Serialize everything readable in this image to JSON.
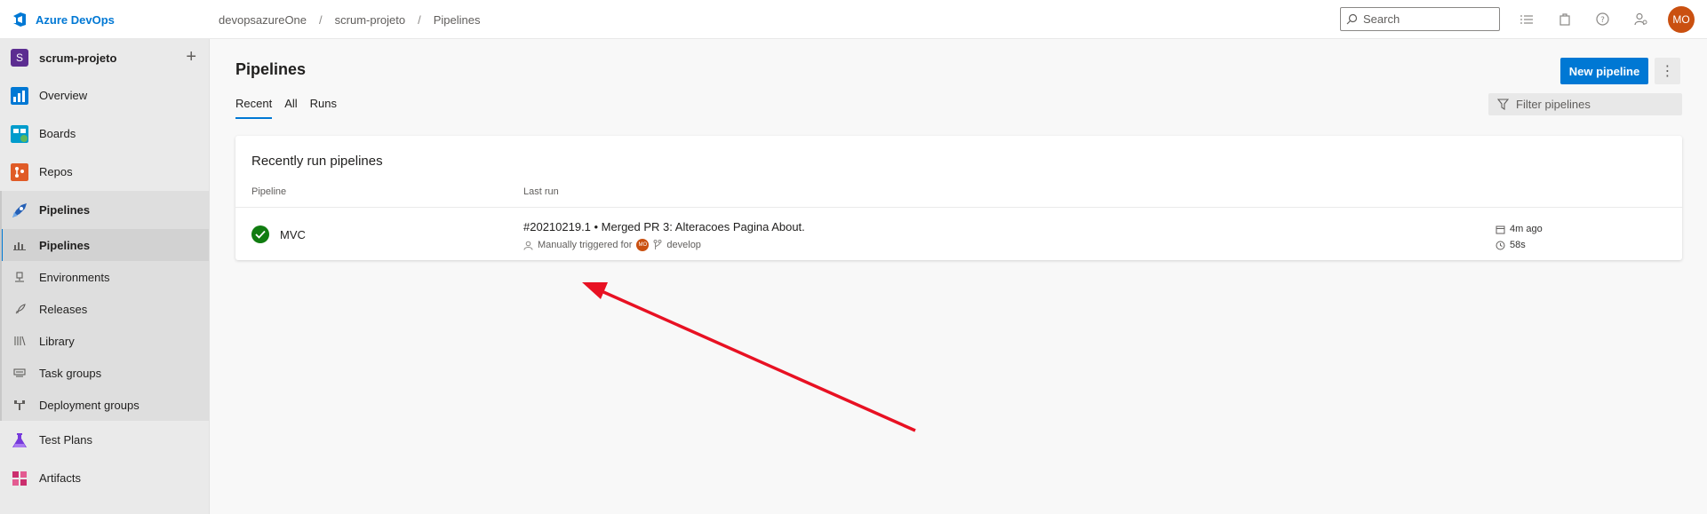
{
  "app": {
    "brand": "Azure DevOps"
  },
  "breadcrumb": [
    "devopsazureOne",
    "scrum-projeto",
    "Pipelines"
  ],
  "search": {
    "placeholder": "Search"
  },
  "user": {
    "initials": "MO",
    "color": "#ca5010"
  },
  "sidebar": {
    "project": {
      "badge": "S",
      "name": "scrum-projeto",
      "add": "+"
    },
    "items": [
      {
        "label": "Overview"
      },
      {
        "label": "Boards"
      },
      {
        "label": "Repos"
      },
      {
        "label": "Pipelines"
      }
    ],
    "sub_items": [
      {
        "label": "Pipelines"
      },
      {
        "label": "Environments"
      },
      {
        "label": "Releases"
      },
      {
        "label": "Library"
      },
      {
        "label": "Task groups"
      },
      {
        "label": "Deployment groups"
      }
    ],
    "bottom_items": [
      {
        "label": "Test Plans"
      },
      {
        "label": "Artifacts"
      }
    ]
  },
  "main": {
    "title": "Pipelines",
    "new_button": "New pipeline",
    "more_button": "⋮",
    "tabs": [
      {
        "label": "Recent"
      },
      {
        "label": "All"
      },
      {
        "label": "Runs"
      }
    ],
    "filter_placeholder": "Filter pipelines",
    "card": {
      "title": "Recently run pipelines",
      "col_pipeline": "Pipeline",
      "col_last_run": "Last run",
      "rows": [
        {
          "name": "MVC",
          "run_title": "#20210219.1 • Merged PR 3: Alteracoes Pagina About.",
          "trigger": "Manually triggered for",
          "trigger_user": "MO",
          "branch": "develop",
          "ago": "4m ago",
          "duration": "58s"
        }
      ]
    }
  },
  "colors": {
    "accent": "#0078d4",
    "success": "#107c10",
    "annotation_arrow": "#e81123"
  }
}
